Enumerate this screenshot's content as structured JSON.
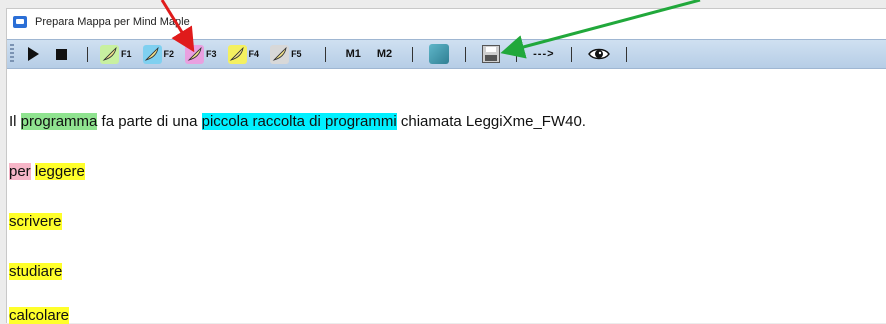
{
  "window": {
    "title": "Prepara Mappa per Mind Maple"
  },
  "toolbar": {
    "f_labels": [
      "F1",
      "F2",
      "F3",
      "F4",
      "F5"
    ],
    "feather_colors": [
      "#c8f0a0",
      "#7fd0f0",
      "#e9a0e0",
      "#f4f060",
      "#d8d8d8"
    ],
    "m1_label": "M1",
    "m2_label": "M2",
    "arrow_label": "--->"
  },
  "content": {
    "line1": {
      "before": "Il ",
      "green": "programma",
      "middle": " fa parte di una ",
      "cyan": "piccola raccolta di programmi",
      "after": " chiamata LeggiXme_FW40."
    },
    "line2": {
      "pink": "per",
      "space": " ",
      "yellow": "leggere"
    },
    "line3": "scrivere",
    "line4": "studiare",
    "line5": "calcolare"
  },
  "colors": {
    "highlight_green": "#8fe38f",
    "highlight_cyan": "#00f0ff",
    "highlight_pink": "#f7b6c8",
    "highlight_yellow": "#ffff2a",
    "arrow_red": "#e01b1b",
    "arrow_green": "#21a83b"
  }
}
